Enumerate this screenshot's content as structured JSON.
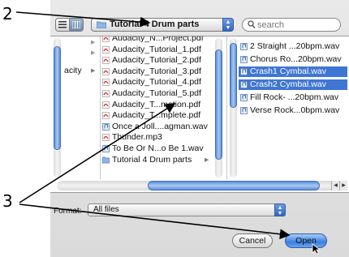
{
  "annotations": {
    "callout_top": "2",
    "callout_bottom": "3"
  },
  "toolbar": {
    "view_list_icon": "list-view-icon",
    "view_column_icon": "column-view-icon",
    "path_popup_label": "Tutorial 4 Drum parts",
    "search_placeholder": "search"
  },
  "columns": {
    "sidebar": {
      "items": [
        {
          "label": "acity",
          "icon": "disclosure-arrow"
        }
      ]
    },
    "files": {
      "items": [
        {
          "label": "Audacity_N...Project.pdf",
          "icon": "pdf-icon"
        },
        {
          "label": "Audacity_Tutorial_1.pdf",
          "icon": "pdf-icon"
        },
        {
          "label": "Audacity_Tutorial_2.pdf",
          "icon": "pdf-icon"
        },
        {
          "label": "Audacity_Tutorial_3.pdf",
          "icon": "pdf-icon"
        },
        {
          "label": "Audacity_Tutorial_4.pdf",
          "icon": "pdf-icon"
        },
        {
          "label": "Audacity_Tutorial_5.pdf",
          "icon": "pdf-icon"
        },
        {
          "label": "Audacity_T...mation.pdf",
          "icon": "pdf-icon"
        },
        {
          "label": "Audacity_T...mplete.pdf",
          "icon": "pdf-icon"
        },
        {
          "label": "Once a Joll....agman.wav",
          "icon": "audio-icon"
        },
        {
          "label": "Thunder.mp3",
          "icon": "pdf-icon"
        },
        {
          "label": "To Be Or N...o Be 1.wav",
          "icon": "audio-icon"
        },
        {
          "label": "Tutorial 4 Drum parts",
          "icon": "folder-icon"
        }
      ]
    },
    "drum_parts": {
      "items": [
        {
          "label": "2 Straight ...20bpm.wav",
          "selected": false
        },
        {
          "label": "Chorus Ro...20bpm.wav",
          "selected": false
        },
        {
          "label": "Crash1 Cymbal.wav",
          "selected": true
        },
        {
          "label": "Crash2 Cymbal.wav",
          "selected": true
        },
        {
          "label": "Fill Rock- ...20bpm.wav",
          "selected": false
        },
        {
          "label": "Verse Rock...0bpm.wav",
          "selected": false
        }
      ]
    }
  },
  "format": {
    "label": "Format:",
    "value": "All files"
  },
  "buttons": {
    "cancel": "Cancel",
    "open": "Open"
  },
  "colors": {
    "selection": "#3f76d4",
    "accent": "#3a7fe0"
  }
}
